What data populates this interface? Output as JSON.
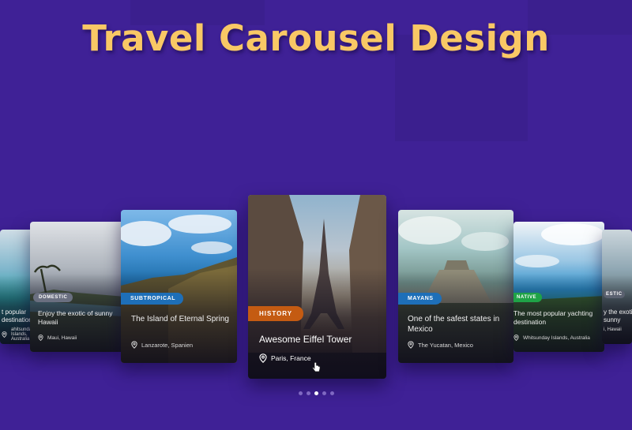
{
  "page": {
    "title": "Travel Carousel Design"
  },
  "colors": {
    "background": "#3f2196",
    "title": "#f9c865",
    "tag_history": "#c45b12",
    "tag_blue": "#1e6fb8",
    "tag_native": "#1fa347"
  },
  "carousel": {
    "cards": [
      {
        "tag": "",
        "title": "t popular\ndestination",
        "location": "ahitsunday Islands, Australia"
      },
      {
        "tag": "DOMESTIC",
        "title": "Enjoy the exotic of sunny Hawaii",
        "location": "Maui, Hawaii"
      },
      {
        "tag": "SUBTROPICAL",
        "title": "The Island of Eternal Spring",
        "location": "Lanzarote, Spanien"
      },
      {
        "tag": "HISTORY",
        "title": "Awesome Eiffel Tower",
        "location": "Paris, France"
      },
      {
        "tag": "MAYANS",
        "title": "One of the safest states in Mexico",
        "location": "The Yucatan, Mexico"
      },
      {
        "tag": "NATIVE",
        "title": "The most popular yachting destination",
        "location": "Whitsunday Islands, Australia"
      },
      {
        "tag": "ESTIC",
        "title": "y the exotic\nsunny",
        "location": "i, Hawaii"
      }
    ],
    "active_index": 3,
    "dot_count": 5,
    "active_dot": 2
  },
  "icons": {
    "location": "location-pin-icon",
    "cursor": "hand-pointer-icon"
  }
}
